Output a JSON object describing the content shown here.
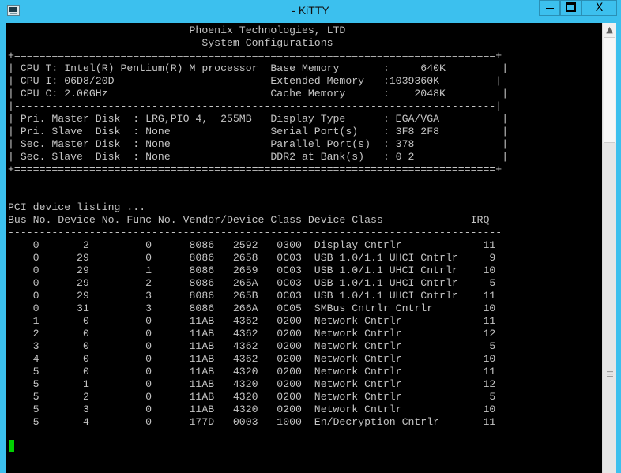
{
  "window": {
    "title": "- KiTTY",
    "icon": "terminal-icon",
    "buttons": {
      "minimize": "minimize-icon",
      "maximize": "maximize-icon",
      "close_label": "X"
    },
    "accent_color": "#3cc0ee"
  },
  "terminal": {
    "background": "#000000",
    "foreground": "#c4c4c4",
    "cursor_color": "#00d000",
    "lines": [
      "                             Phoenix Technologies, LTD",
      "                               System Configurations",
      "+=============================================================================+",
      "| CPU T: Intel(R) Pentium(R) M processor  Base Memory       :     640K         |",
      "| CPU I: 06D8/20D                         Extended Memory   :1039360K         |",
      "| CPU C: 2.00GHz                          Cache Memory      :    2048K         |",
      "|-----------------------------------------------------------------------------|",
      "| Pri. Master Disk  : LRG,PIO 4,  255MB   Display Type      : EGA/VGA          |",
      "| Pri. Slave  Disk  : None                Serial Port(s)    : 3F8 2F8          |",
      "| Sec. Master Disk  : None                Parallel Port(s)  : 378              |",
      "| Sec. Slave  Disk  : None                DDR2 at Bank(s)   : 0 2              |",
      "+=============================================================================+",
      "",
      "",
      "PCI device listing ...",
      "Bus No. Device No. Func No. Vendor/Device Class Device Class              IRQ",
      "-------------------------------------------------------------------------------",
      "    0       2         0      8086   2592   0300  Display Cntrlr             11",
      "    0      29         0      8086   2658   0C03  USB 1.0/1.1 UHCI Cntrlr     9",
      "    0      29         1      8086   2659   0C03  USB 1.0/1.1 UHCI Cntrlr    10",
      "    0      29         2      8086   265A   0C03  USB 1.0/1.1 UHCI Cntrlr     5",
      "    0      29         3      8086   265B   0C03  USB 1.0/1.1 UHCI Cntrlr    11",
      "    0      31         3      8086   266A   0C05  SMBus Cntrlr Cntrlr        10",
      "    1       0         0      11AB   4362   0200  Network Cntrlr             11",
      "    2       0         0      11AB   4362   0200  Network Cntrlr             12",
      "    3       0         0      11AB   4362   0200  Network Cntrlr              5",
      "    4       0         0      11AB   4362   0200  Network Cntrlr             10",
      "    5       0         0      11AB   4320   0200  Network Cntrlr             11",
      "    5       1         0      11AB   4320   0200  Network Cntrlr             12",
      "    5       2         0      11AB   4320   0200  Network Cntrlr              5",
      "    5       3         0      11AB   4320   0200  Network Cntrlr             10",
      "    5       4         0      177D   0003   1000  En/Decryption Cntrlr       11"
    ]
  },
  "scrollbar": {
    "up_arrow": "chevron-up-icon",
    "grip_icon": "grip-icon"
  }
}
